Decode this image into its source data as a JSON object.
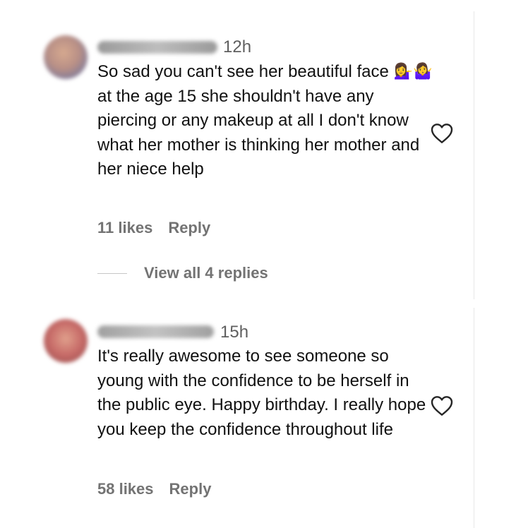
{
  "comments": [
    {
      "time": "12h",
      "text_before": "So sad you can't see her beautiful face ",
      "emojis": [
        "💁‍♀️",
        "🤷‍♀️"
      ],
      "text_after": " at the age 15 she shouldn't have any piercing or any makeup at all I don't know what her mother is thinking her mother and her niece help",
      "likes": "11 likes",
      "reply_label": "Reply",
      "view_replies": "View all 4 replies",
      "avatar_color": "#b88f86",
      "like_icon": "heart-outline-icon"
    },
    {
      "time": "15h",
      "text": "It's really awesome to see someone so young with the confidence to be herself in the public eye. Happy birthday. I really hope you keep the confidence throughout life",
      "likes": "58 likes",
      "reply_label": "Reply",
      "avatar_color": "#c76b68",
      "like_icon": "heart-outline-icon"
    }
  ]
}
